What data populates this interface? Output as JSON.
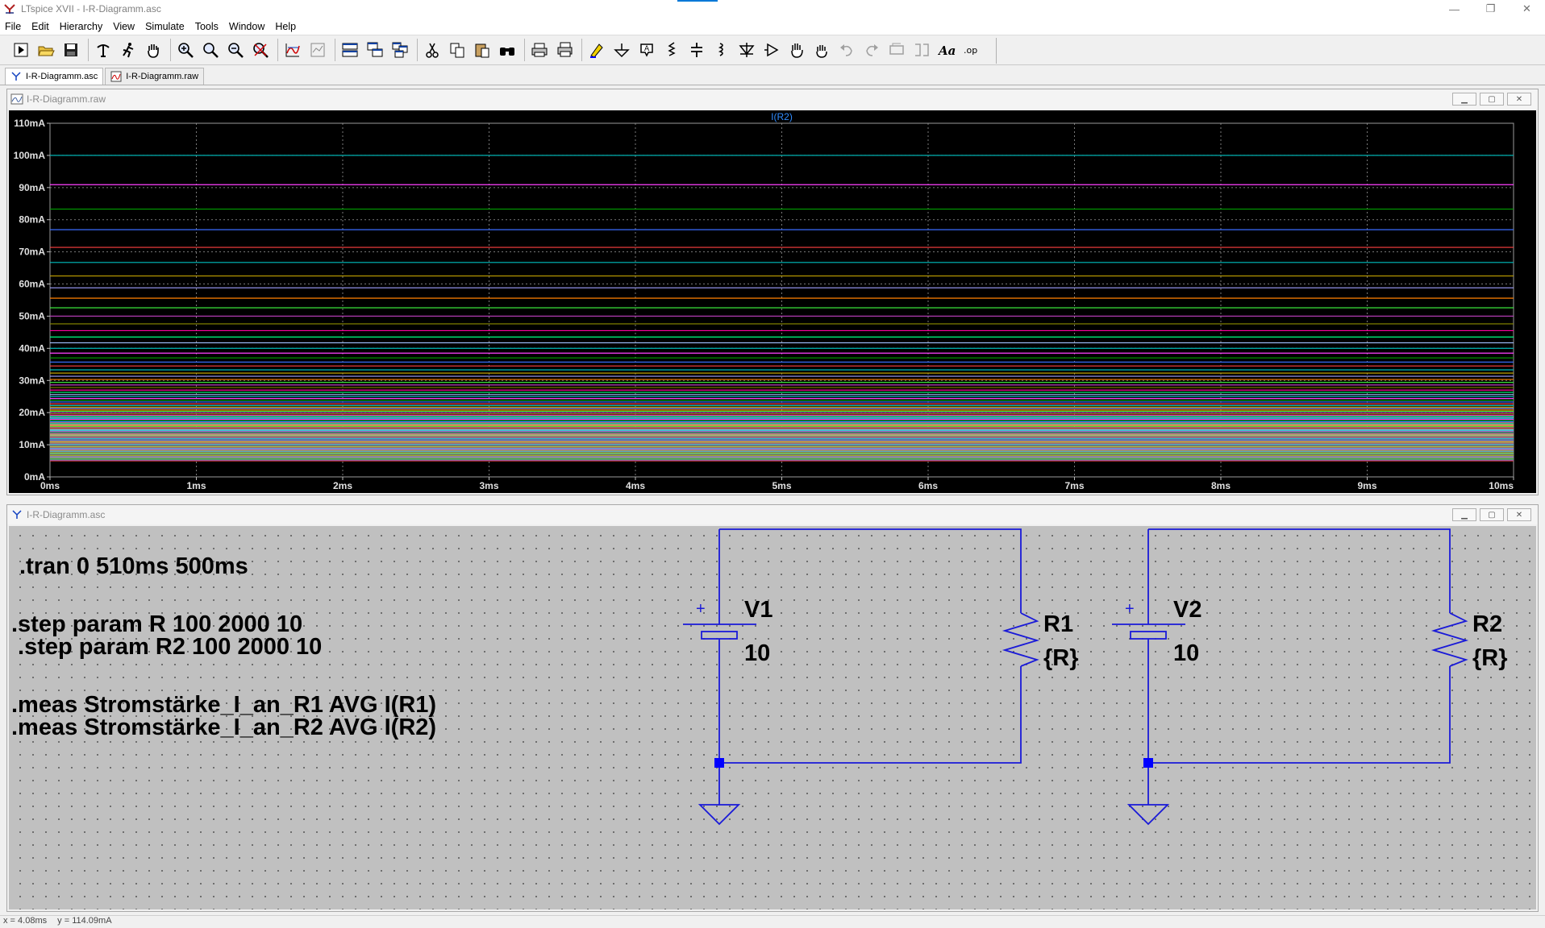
{
  "app": {
    "title": "LTspice XVII - I-R-Diagramm.asc",
    "window_controls": [
      "—",
      "❐",
      "✕"
    ]
  },
  "menu": [
    {
      "label": "File"
    },
    {
      "label": "Edit"
    },
    {
      "label": "Hierarchy"
    },
    {
      "label": "View"
    },
    {
      "label": "Simulate"
    },
    {
      "label": "Tools"
    },
    {
      "label": "Window"
    },
    {
      "label": "Help"
    }
  ],
  "toolbar": {
    "groups": [
      [
        "run-icon",
        "open-icon",
        "save-icon"
      ],
      [
        "control-panel-icon",
        "run-sim-icon",
        "pan-hand-icon"
      ],
      [
        "zoom-in-icon",
        "zoom-area-icon",
        "zoom-out-icon",
        "zoom-fit-icon"
      ],
      [
        "autoscale-icon",
        "pick-traces-icon"
      ],
      [
        "tile-horizontal-icon",
        "cascade-icon",
        "tile-vertical-icon"
      ],
      [
        "cut-icon",
        "copy-icon",
        "paste-icon",
        "find-icon"
      ],
      [
        "print-icon",
        "print-preview-icon"
      ],
      [
        "wire-icon",
        "ground-icon",
        "label-net-icon",
        "resistor-icon",
        "capacitor-icon",
        "inductor-icon",
        "diode-icon",
        "component-icon",
        "move-icon",
        "drag-icon",
        "undo-icon",
        "redo-icon",
        "rotate-icon",
        "mirror-icon",
        "text-icon",
        "spice-directive-icon"
      ]
    ],
    "text_button": "Aa",
    "op_button": ".op"
  },
  "tabs": [
    {
      "label": "I-R-Diagramm.asc",
      "active": true
    },
    {
      "label": "I-R-Diagramm.raw",
      "active": false
    }
  ],
  "plot_window": {
    "title": "I-R-Diagramm.raw"
  },
  "schematic_window": {
    "title": "I-R-Diagramm.asc",
    "directives": [
      ".tran 0 510ms 500ms",
      ".step param R 100 2000 10",
      " .step param R2 100 2000 10",
      ".meas Stromstärke_I_an_R1 AVG I(R1)",
      ".meas Stromstärke_I_an_R2 AVG I(R2)"
    ],
    "components": {
      "V1": {
        "name": "V1",
        "value": "10",
        "plus": "+"
      },
      "R1": {
        "name": "R1",
        "value": "{R}"
      },
      "V2": {
        "name": "V2",
        "value": "10",
        "plus": "+"
      },
      "R2": {
        "name": "R2",
        "value": "{R}"
      }
    },
    "wire_color": "#1a1ad8",
    "junction_color": "#0000ff"
  },
  "status": {
    "x": "x = 4.08ms",
    "y": "y = 114.09mA"
  },
  "chart_data": {
    "type": "line",
    "title": "I(R2)",
    "xlabel": "",
    "ylabel": "",
    "xlim": [
      0,
      10
    ],
    "ylim": [
      0,
      110
    ],
    "x_unit": "ms",
    "y_unit": "mA",
    "x_ticks": [
      "0ms",
      "1ms",
      "2ms",
      "3ms",
      "4ms",
      "5ms",
      "6ms",
      "7ms",
      "8ms",
      "9ms",
      "10ms"
    ],
    "y_ticks": [
      "0mA",
      "10mA",
      "20mA",
      "30mA",
      "40mA",
      "50mA",
      "60mA",
      "70mA",
      "80mA",
      "90mA",
      "100mA",
      "110mA"
    ],
    "grid": true,
    "background": "#000000",
    "title_color": "#2f8cff",
    "grid_color": "#7a7a7a",
    "palette": [
      "#00b0b0",
      "#ff40ff",
      "#00a000",
      "#3a6cff",
      "#ff4040",
      "#00c0c0",
      "#c0a000",
      "#a0a0ff",
      "#ff8000",
      "#40ff40",
      "#c040c0",
      "#808000",
      "#ff00a0",
      "#00ff80",
      "#a0c0ff"
    ],
    "series_values": [
      100,
      90.9,
      83.3,
      76.9,
      71.4,
      66.7,
      62.5,
      58.8,
      55.6,
      52.6,
      50,
      47.6,
      45.5,
      43.5,
      41.7,
      40,
      38.5,
      37,
      35.7,
      34.5,
      33.3,
      32.3,
      31.3,
      30.3,
      29.4,
      28.6,
      27.8,
      27,
      26.3,
      25.6,
      25,
      24.4,
      23.8,
      23.3,
      22.7,
      22.2,
      21.7,
      21.3,
      20.8,
      20.4,
      20,
      19.6,
      19.2,
      18.9,
      18.5,
      18.2,
      17.9,
      17.5,
      17.2,
      16.9,
      16.7,
      16.4,
      16.1,
      15.9,
      15.6,
      15.4,
      15.2,
      14.9,
      14.7,
      14.5,
      14.3,
      14.1,
      13.9,
      13.7,
      13.5,
      13.3,
      13.2,
      13,
      12.8,
      12.7,
      12.5,
      12.3,
      12.2,
      12,
      11.9,
      11.8,
      11.6,
      11.5,
      11.4,
      11.2,
      11.1,
      11,
      10.9,
      10.8,
      10.6,
      10.5,
      10.4,
      10.3,
      10.2,
      10.1,
      10,
      9.9,
      9.8,
      9.7,
      9.6,
      9.5,
      9.4,
      9.3,
      9.3,
      9.2,
      9.1,
      9,
      8.9,
      8.8,
      8.8,
      8.7,
      8.6,
      8.5,
      8.5,
      8.4,
      8.3,
      8.3,
      8.2,
      8.1,
      8.1,
      8,
      7.9,
      7.9,
      7.8,
      7.8,
      7.7,
      7.6,
      7.6,
      7.5,
      7.5,
      7.4,
      7.4,
      7.3,
      7.2,
      7.2,
      7.1,
      7.1,
      7,
      7,
      6.9,
      6.9,
      6.8,
      6.8,
      6.7,
      6.7,
      6.6,
      6.6,
      6.5,
      6.5,
      6.5,
      6.4,
      6.4,
      6.3,
      6.3,
      6.2,
      6.2,
      6.2,
      6.1,
      6.1,
      6,
      6,
      6,
      5.9,
      5.9,
      5.8,
      5.8,
      5.8,
      5.7,
      5.7,
      5.7,
      5.6,
      5.6,
      5.6,
      5.5,
      5.5,
      5.5,
      5.4,
      5.4,
      5.4,
      5.3,
      5.3,
      5.3,
      5.2,
      5.2,
      5.2,
      5.2,
      5.1,
      5.1,
      5.1,
      5
    ]
  }
}
